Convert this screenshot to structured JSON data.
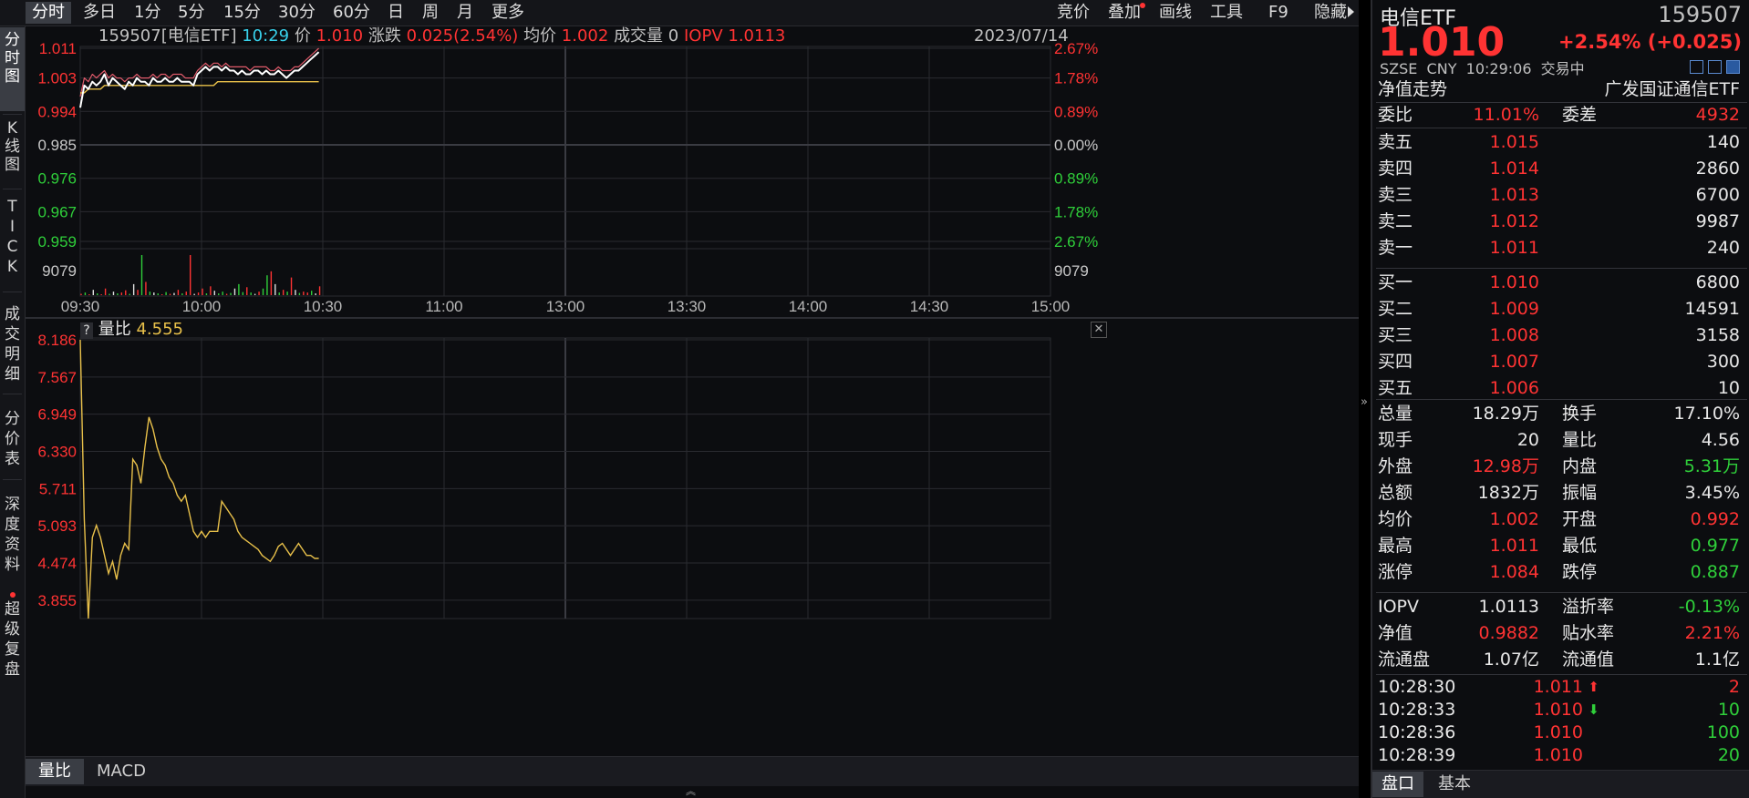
{
  "toolbar": {
    "periods": [
      "分时",
      "多日",
      "1分",
      "5分",
      "15分",
      "30分",
      "60分",
      "日",
      "周",
      "月",
      "更多"
    ],
    "tools": [
      "竞价",
      "叠加",
      "画线",
      "工具",
      "F9",
      "隐藏"
    ]
  },
  "left_tabs": [
    {
      "label": "分\n时\n图"
    },
    {
      "label": "K\n线\n图"
    },
    {
      "label": "T\nI\nC\nK"
    },
    {
      "label": "成\n交\n明\n细"
    },
    {
      "label": "分\n价\n表"
    },
    {
      "label": "深\n度\n资\n料"
    },
    {
      "label": "超\n级\n复\n盘"
    }
  ],
  "chart_header": {
    "code": "159507[电信ETF]",
    "time": "10:29",
    "price_label": "价",
    "price": "1.010",
    "change_label": "涨跌",
    "change": "0.025(2.54%)",
    "avg_label": "均价",
    "avg": "1.002",
    "volume_label": "成交量",
    "volume": "0",
    "iopv_label": "IOPV",
    "iopv": "1.0113",
    "date": "2023/07/14"
  },
  "colors": {
    "red": "#ff3333",
    "green": "#2fcf3a",
    "price_line": "#ffffff",
    "avg_line": "#e8c04a",
    "ratio_line": "#e8c04a",
    "grid": "#2a2b30"
  },
  "chart_data": [
    {
      "type": "line",
      "x_ticks": [
        "09:30",
        "10:00",
        "10:30",
        "11:00",
        "13:00",
        "13:30",
        "14:00",
        "14:30",
        "15:00"
      ],
      "y_left_ticks": [
        "1.011",
        "1.003",
        "0.994",
        "0.985",
        "0.976",
        "0.967",
        "0.959"
      ],
      "y_right_ticks": [
        "2.67%",
        "1.78%",
        "0.89%",
        "0.00%",
        "0.89%",
        "1.78%",
        "2.67%"
      ],
      "volume_tick": "9079",
      "ylim": [
        0.959,
        1.011
      ],
      "prev_close": 0.985,
      "series": [],
      "price": [
        0.995,
        1.001,
        1.0,
        1.002,
        1.001,
        1.002,
        1.004,
        1.001,
        1.003,
        1.002,
        1.001,
        1.0,
        1.002,
        1.001,
        1.003,
        1.002,
        1.002,
        1.001,
        1.003,
        1.002,
        1.002,
        1.003,
        1.002,
        1.002,
        1.003,
        1.002,
        1.002,
        1.002,
        1.001,
        1.004,
        1.005,
        1.006,
        1.005,
        1.006,
        1.006,
        1.005,
        1.006,
        1.005,
        1.005,
        1.004,
        1.005,
        1.004,
        1.004,
        1.005,
        1.005,
        1.004,
        1.005,
        1.004,
        1.004,
        1.005,
        1.004,
        1.003,
        1.004,
        1.005,
        1.005,
        1.006,
        1.007,
        1.008,
        1.009,
        1.01
      ],
      "average": [
        0.999,
        0.999,
        1.0,
        1.0,
        1.0,
        1.0,
        1.001,
        1.001,
        1.001,
        1.001,
        1.001,
        1.001,
        1.001,
        1.001,
        1.001,
        1.001,
        1.001,
        1.001,
        1.001,
        1.001,
        1.001,
        1.001,
        1.001,
        1.001,
        1.001,
        1.001,
        1.001,
        1.001,
        1.001,
        1.001,
        1.001,
        1.001,
        1.001,
        1.001,
        1.002,
        1.002,
        1.002,
        1.002,
        1.002,
        1.002,
        1.002,
        1.002,
        1.002,
        1.002,
        1.002,
        1.002,
        1.002,
        1.002,
        1.002,
        1.002,
        1.002,
        1.002,
        1.002,
        1.002,
        1.002,
        1.002,
        1.002,
        1.002,
        1.002,
        1.002
      ],
      "iopv": [
        0.998,
        1.003,
        1.002,
        1.004,
        1.003,
        1.004,
        1.005,
        1.003,
        1.004,
        1.003,
        1.003,
        1.002,
        1.003,
        1.003,
        1.004,
        1.003,
        1.003,
        1.003,
        1.004,
        1.003,
        1.004,
        1.004,
        1.003,
        1.004,
        1.004,
        1.004,
        1.003,
        1.003,
        1.003,
        1.005,
        1.006,
        1.007,
        1.006,
        1.007,
        1.007,
        1.006,
        1.007,
        1.006,
        1.006,
        1.006,
        1.006,
        1.006,
        1.005,
        1.006,
        1.006,
        1.006,
        1.006,
        1.005,
        1.005,
        1.006,
        1.005,
        1.005,
        1.005,
        1.006,
        1.006,
        1.007,
        1.008,
        1.009,
        1.01,
        1.011
      ],
      "volume": [
        300,
        600,
        200,
        1200,
        400,
        200,
        1500,
        300,
        800,
        400,
        600,
        1100,
        300,
        2500,
        1200,
        9079,
        3000,
        800,
        600,
        400,
        200,
        700,
        300,
        500,
        1200,
        400,
        800,
        9079,
        300,
        600,
        1500,
        400,
        2000,
        1000,
        400,
        800,
        300,
        500,
        1500,
        2500,
        700,
        1800,
        600,
        300,
        800,
        1500,
        4500,
        5400,
        2500,
        600,
        1200,
        800,
        4000,
        1200,
        500,
        800,
        600,
        1000,
        400,
        2000
      ],
      "volume_up": [
        1,
        0,
        1,
        1,
        0,
        1,
        1,
        0,
        1,
        0,
        1,
        1,
        0,
        1,
        1,
        0,
        1,
        0,
        1,
        0,
        1,
        0,
        1,
        0,
        1,
        0,
        1,
        1,
        0,
        1,
        1,
        0,
        1,
        1,
        0,
        0,
        1,
        0,
        1,
        0,
        0,
        1,
        0,
        1,
        1,
        0,
        0,
        1,
        1,
        0,
        1,
        0,
        1,
        1,
        0,
        1,
        1,
        0,
        1,
        1
      ]
    },
    {
      "type": "line",
      "title": "量比",
      "value_label": "4.555",
      "y_ticks": [
        "8.186",
        "7.567",
        "6.949",
        "6.330",
        "5.711",
        "5.093",
        "4.474",
        "3.855"
      ],
      "ylim": [
        3.55,
        8.186
      ],
      "series": [],
      "values": [
        8.186,
        5.2,
        3.4,
        4.9,
        5.1,
        4.9,
        4.6,
        4.3,
        4.5,
        4.2,
        4.6,
        4.8,
        4.7,
        6.2,
        6.1,
        5.8,
        6.4,
        6.9,
        6.7,
        6.4,
        6.2,
        6.1,
        5.9,
        5.8,
        5.6,
        5.5,
        5.6,
        5.3,
        5.0,
        4.9,
        5.0,
        4.9,
        5.0,
        5.0,
        5.0,
        5.5,
        5.4,
        5.3,
        5.2,
        5.0,
        4.9,
        4.85,
        4.8,
        4.75,
        4.7,
        4.6,
        4.55,
        4.5,
        4.6,
        4.75,
        4.8,
        4.7,
        4.6,
        4.7,
        4.8,
        4.7,
        4.6,
        4.6,
        4.55,
        4.55
      ]
    }
  ],
  "bottom_tabs": [
    "量比",
    "MACD"
  ],
  "panel": {
    "name": "电信ETF",
    "code": "159507",
    "price": "1.010",
    "change": "+2.54% (+0.025)",
    "meta": "SZSE  CNY  10:29:06  交易中",
    "nav_trend": "净值走势",
    "fund_name": "广发国证通信ETF",
    "commission": {
      "label1": "委比",
      "value1": "11.01%",
      "label2": "委差",
      "value2": "4932"
    },
    "asks": [
      {
        "label": "卖五",
        "price": "1.015",
        "vol": "140"
      },
      {
        "label": "卖四",
        "price": "1.014",
        "vol": "2860"
      },
      {
        "label": "卖三",
        "price": "1.013",
        "vol": "6700"
      },
      {
        "label": "卖二",
        "price": "1.012",
        "vol": "9987"
      },
      {
        "label": "卖一",
        "price": "1.011",
        "vol": "240"
      }
    ],
    "bids": [
      {
        "label": "买一",
        "price": "1.010",
        "vol": "6800"
      },
      {
        "label": "买二",
        "price": "1.009",
        "vol": "14591"
      },
      {
        "label": "买三",
        "price": "1.008",
        "vol": "3158"
      },
      {
        "label": "买四",
        "price": "1.007",
        "vol": "300"
      },
      {
        "label": "买五",
        "price": "1.006",
        "vol": "10"
      }
    ],
    "stats": [
      {
        "l1": "总量",
        "v1": "18.29万",
        "c1": "white",
        "l2": "换手",
        "v2": "17.10%",
        "c2": "white"
      },
      {
        "l1": "现手",
        "v1": "20",
        "c1": "white",
        "l2": "量比",
        "v2": "4.56",
        "c2": "white"
      },
      {
        "l1": "外盘",
        "v1": "12.98万",
        "c1": "red",
        "l2": "内盘",
        "v2": "5.31万",
        "c2": "green"
      },
      {
        "l1": "总额",
        "v1": "1832万",
        "c1": "white",
        "l2": "振幅",
        "v2": "3.45%",
        "c2": "white"
      },
      {
        "l1": "均价",
        "v1": "1.002",
        "c1": "red",
        "l2": "开盘",
        "v2": "0.992",
        "c2": "red"
      },
      {
        "l1": "最高",
        "v1": "1.011",
        "c1": "red",
        "l2": "最低",
        "v2": "0.977",
        "c2": "green"
      },
      {
        "l1": "涨停",
        "v1": "1.084",
        "c1": "red",
        "l2": "跌停",
        "v2": "0.887",
        "c2": "green"
      }
    ],
    "fund_stats": [
      {
        "l1": "IOPV",
        "v1": "1.0113",
        "c1": "white",
        "l2": "溢折率",
        "v2": "-0.13%",
        "c2": "green"
      },
      {
        "l1": "净值",
        "v1": "0.9882",
        "c1": "red",
        "l2": "贴水率",
        "v2": "2.21%",
        "c2": "red"
      },
      {
        "l1": "流通盘",
        "v1": "1.07亿",
        "c1": "white",
        "l2": "流通值",
        "v2": "1.1亿",
        "c2": "white"
      }
    ],
    "ticks": [
      {
        "time": "10:28:30",
        "price": "1.011",
        "dir": "up",
        "vol": "2",
        "vcolor": "red"
      },
      {
        "time": "10:28:33",
        "price": "1.010",
        "dir": "down",
        "vol": "10",
        "vcolor": "green"
      },
      {
        "time": "10:28:36",
        "price": "1.010",
        "dir": "",
        "vol": "100",
        "vcolor": "green"
      },
      {
        "time": "10:28:39",
        "price": "1.010",
        "dir": "",
        "vol": "20",
        "vcolor": "green"
      }
    ],
    "tabs": [
      "盘口",
      "基本"
    ]
  }
}
